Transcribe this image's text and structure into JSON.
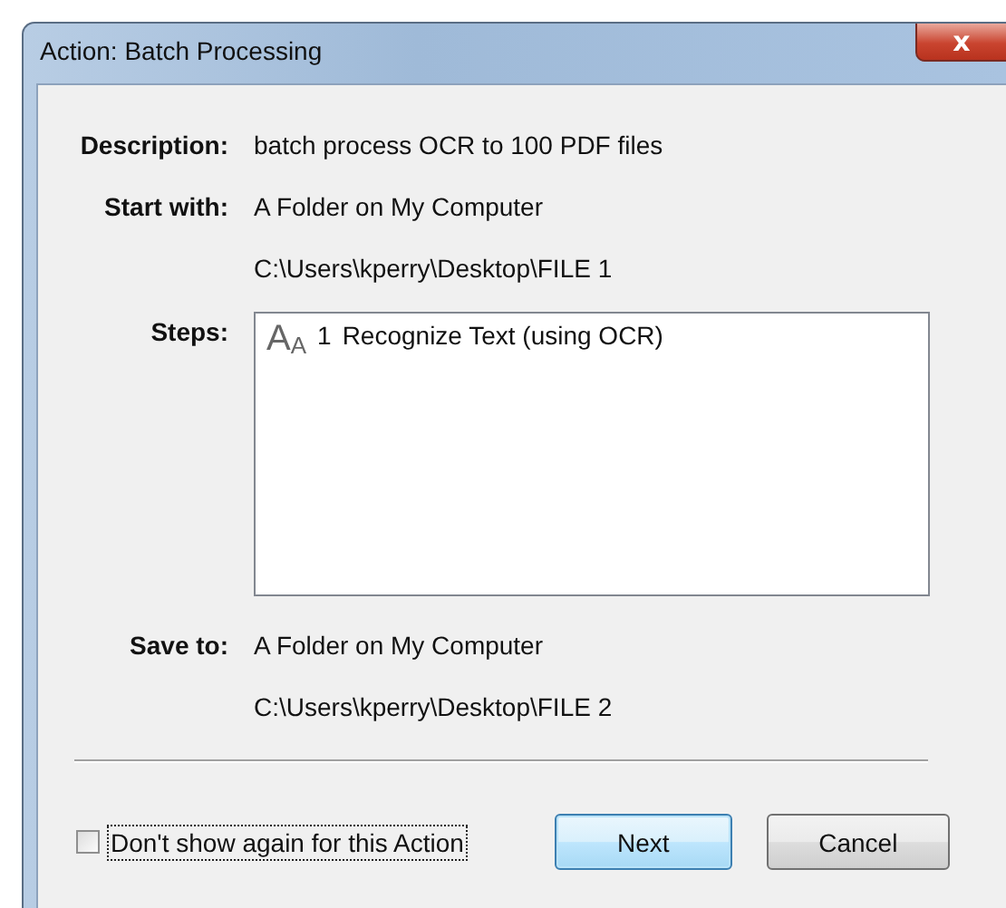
{
  "window": {
    "title": "Action: Batch Processing",
    "close": "x"
  },
  "description": {
    "label": "Description:",
    "value": "batch process OCR to 100 PDF files"
  },
  "start_with": {
    "label": "Start with:",
    "value": "A Folder on My Computer",
    "path": "C:\\Users\\kperry\\Desktop\\FILE 1"
  },
  "steps": {
    "label": "Steps:",
    "items": [
      {
        "icon": [
          "A",
          "A"
        ],
        "number": "1",
        "text": "Recognize Text (using OCR)"
      }
    ]
  },
  "save_to": {
    "label": "Save to:",
    "value": "A Folder on My Computer",
    "path": "C:\\Users\\kperry\\Desktop\\FILE 2"
  },
  "checkbox": {
    "label": "Don't show again for this Action",
    "checked": false,
    "focused": true
  },
  "buttons": [
    {
      "label": "Next",
      "default": true
    },
    {
      "label": "Cancel",
      "default": false
    }
  ]
}
